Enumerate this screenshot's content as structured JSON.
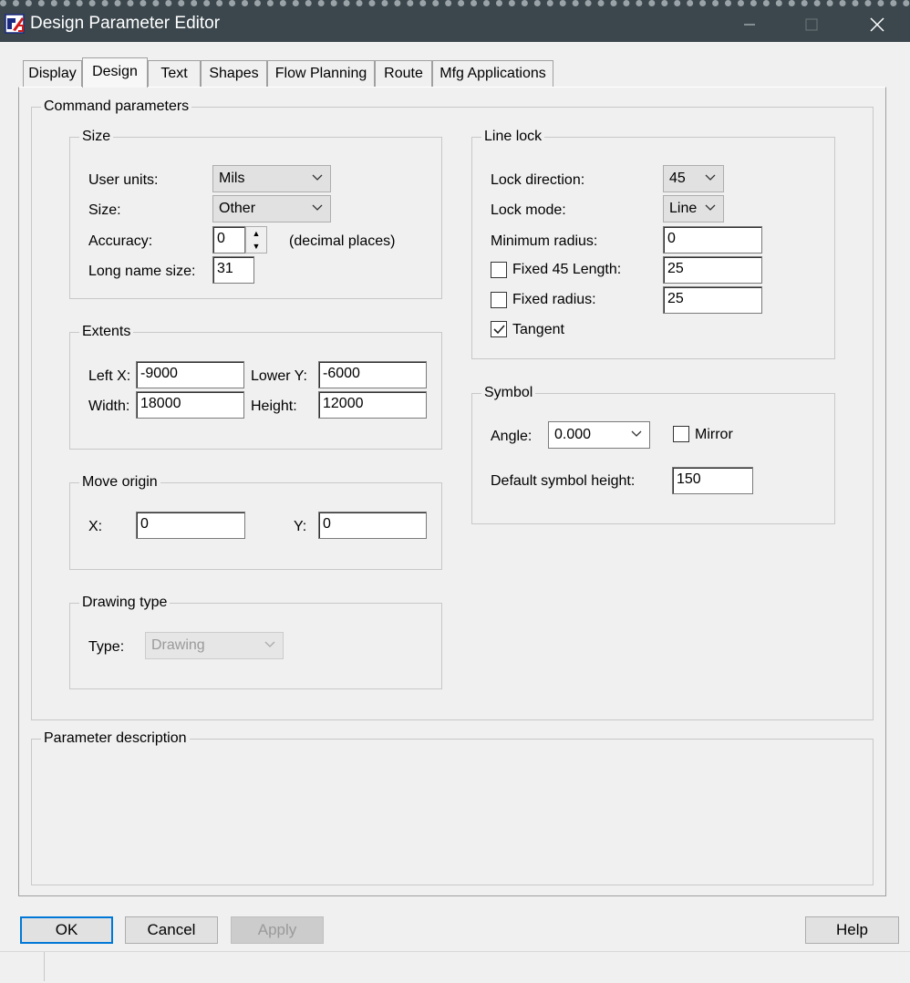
{
  "window": {
    "title": "Design Parameter Editor"
  },
  "tabs": [
    "Display",
    "Design",
    "Text",
    "Shapes",
    "Flow Planning",
    "Route",
    "Mfg Applications"
  ],
  "command_parameters": {
    "legend": "Command parameters",
    "size": {
      "legend": "Size",
      "user_units_label": "User units:",
      "user_units_value": "Mils",
      "size_label": "Size:",
      "size_value": "Other",
      "accuracy_label": "Accuracy:",
      "accuracy_value": "0",
      "accuracy_suffix": "(decimal places)",
      "long_name_label": "Long name size:",
      "long_name_value": "31"
    },
    "extents": {
      "legend": "Extents",
      "left_x_label": "Left X:",
      "left_x_value": "-9000",
      "lower_y_label": "Lower Y:",
      "lower_y_value": "-6000",
      "width_label": "Width:",
      "width_value": "18000",
      "height_label": "Height:",
      "height_value": "12000"
    },
    "move_origin": {
      "legend": "Move origin",
      "x_label": "X:",
      "x_value": "0",
      "y_label": "Y:",
      "y_value": "0"
    },
    "drawing_type": {
      "legend": "Drawing type",
      "type_label": "Type:",
      "type_value": "Drawing"
    },
    "line_lock": {
      "legend": "Line lock",
      "lock_direction_label": "Lock direction:",
      "lock_direction_value": "45",
      "lock_mode_label": "Lock mode:",
      "lock_mode_value": "Line",
      "minimum_radius_label": "Minimum radius:",
      "minimum_radius_value": "0",
      "fixed45_label": "Fixed 45 Length:",
      "fixed45_value": "25",
      "fixed45_checked": false,
      "fixed_radius_label": "Fixed radius:",
      "fixed_radius_value": "25",
      "fixed_radius_checked": false,
      "tangent_label": "Tangent",
      "tangent_checked": true
    },
    "symbol": {
      "legend": "Symbol",
      "angle_label": "Angle:",
      "angle_value": "0.000",
      "mirror_label": "Mirror",
      "mirror_checked": false,
      "default_height_label": "Default symbol height:",
      "default_height_value": "150"
    }
  },
  "parameter_description": {
    "legend": "Parameter description"
  },
  "buttons": {
    "ok": "OK",
    "cancel": "Cancel",
    "apply": "Apply",
    "help": "Help"
  },
  "colors": {
    "titlebar": "#3b474d",
    "focus": "#0078d7",
    "face": "#f0f0f0"
  }
}
